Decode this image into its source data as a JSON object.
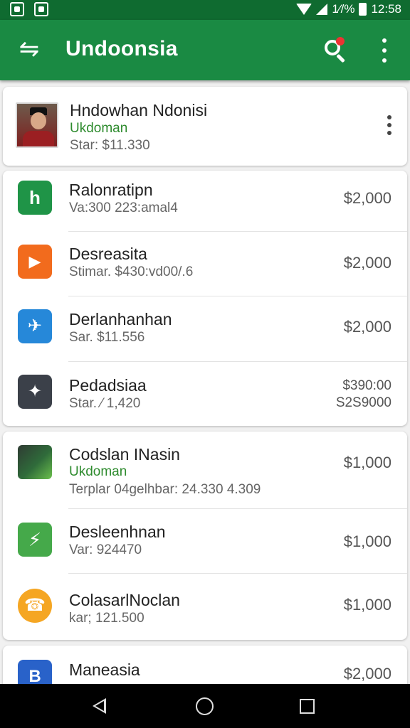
{
  "status_bar": {
    "time": "12:58",
    "battery_text": "1⁄/%"
  },
  "app_bar": {
    "title": "Undoonsia",
    "menu_icon": "back-arrows-icon",
    "search_icon": "search-icon",
    "overflow_icon": "more-vert-icon"
  },
  "profile": {
    "name": "Hndowhan Ndonisi",
    "subtitle": "Ukdoman",
    "stat": "Star: $11.330"
  },
  "group1": [
    {
      "title": "Ralonratipn",
      "meta": "Va:300 223:amal4",
      "price": "$2,000",
      "icon": "h-logo-icon",
      "color": "#1f9447"
    },
    {
      "title": "Desreasita",
      "meta": "Stimar. $430:vd00/.6",
      "price": "$2,000",
      "icon": "play-icon",
      "color": "#f26b1d"
    },
    {
      "title": "Derlanhanhan",
      "meta": "Sar. $11.556",
      "price": "$2,000",
      "icon": "bird-icon",
      "color": "#2688d9"
    },
    {
      "title": "Pedadsiaa",
      "meta": "Star. ⁄ 1,420",
      "price_line1": "$390:00",
      "price_line2": "S2S9000",
      "icon": "sparkle-icon",
      "color": "#3b4049"
    }
  ],
  "group2": [
    {
      "title": "Codslan INasin",
      "subtitle": "Ukdoman",
      "meta": "Terplar 04gelhbar: 24.330 4.309",
      "price": "$1,000",
      "icon": "app-photo-icon",
      "color": "#2f6b3a"
    },
    {
      "title": "Desleenhnan",
      "meta": "Var: 924470",
      "price": "$1,000",
      "icon": "lightning-icon",
      "color": "#45a94a"
    },
    {
      "title": "ColasarlNoclan",
      "meta": "kar; 121.500",
      "price": "$1,000",
      "icon": "phone-icon",
      "color": "#f5a623"
    }
  ],
  "group3": [
    {
      "title": "Maneasia",
      "price": "$2,000",
      "icon": "b-logo-icon",
      "color": "#2962c9"
    }
  ],
  "nav_bar": {
    "back": "back-icon",
    "home": "home-icon",
    "recents": "recents-icon"
  }
}
